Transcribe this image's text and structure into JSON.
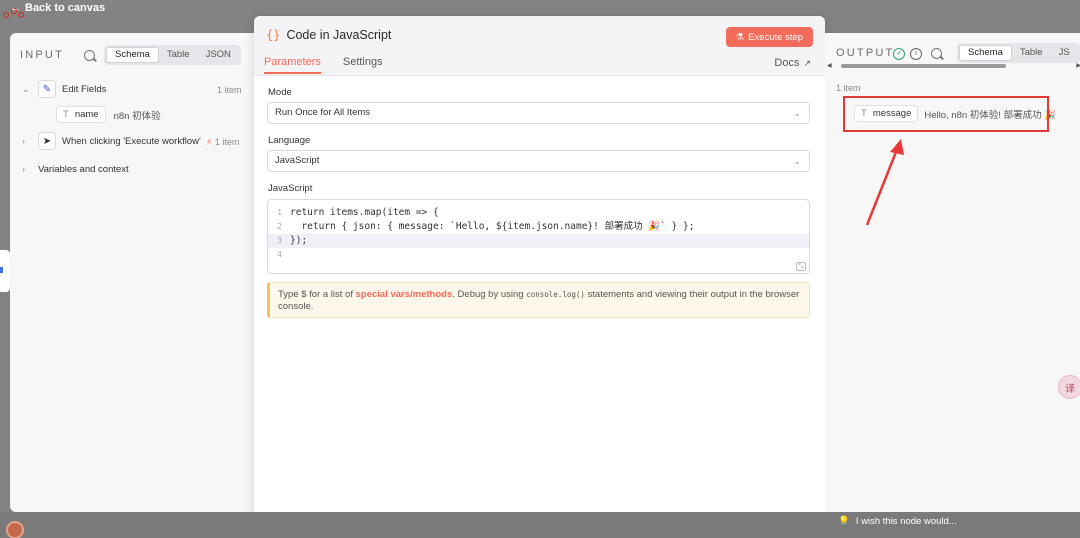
{
  "topbar": {
    "back_label": "Back to canvas"
  },
  "input_panel": {
    "title": "INPUT",
    "view_tabs": [
      "Schema",
      "Table",
      "JSON"
    ],
    "tree": [
      {
        "label": "Edit Fields",
        "count": "1 item",
        "expanded": true,
        "fields": [
          {
            "type_icon": "T",
            "name": "name",
            "value": "n8n 初体验"
          }
        ]
      },
      {
        "label": "When clicking 'Execute workflow'",
        "count": "1 item",
        "expanded": false
      },
      {
        "label": "Variables and context",
        "expanded": false
      }
    ]
  },
  "dialog": {
    "icon": "{}",
    "title": "Code in JavaScript",
    "execute_label": "Execute step",
    "tabs": [
      "Parameters",
      "Settings"
    ],
    "docs_label": "Docs",
    "mode": {
      "label": "Mode",
      "value": "Run Once for All Items"
    },
    "language": {
      "label": "Language",
      "value": "JavaScript"
    },
    "code": {
      "label": "JavaScript",
      "line_numbers": [
        "1",
        "2",
        "3",
        "4"
      ],
      "lines": [
        "return items.map(item => {",
        "  return { json: { message: `Hello, ${item.json.name}! 部署成功 🎉` } };",
        "});",
        ""
      ]
    },
    "hint": {
      "prefix": "Type $ for a list of ",
      "highlight": "special vars/methods",
      "middle": ". Debug by using ",
      "code": "console.log()",
      "suffix": " statements and viewing their output in the browser",
      "line2": "console."
    }
  },
  "output_panel": {
    "title": "OUTPUT",
    "view_tabs": [
      "Schema",
      "Table",
      "JS"
    ],
    "count": "1 item",
    "field": {
      "type_icon": "T",
      "name": "message",
      "value": "Hello, n8n 初体验! 部署成功 🎉"
    }
  },
  "footer": {
    "wish_label": "I wish this node would..."
  },
  "colors": {
    "accent": "#f26b5b",
    "annotation": "#e53935",
    "success": "#2aa36b"
  }
}
